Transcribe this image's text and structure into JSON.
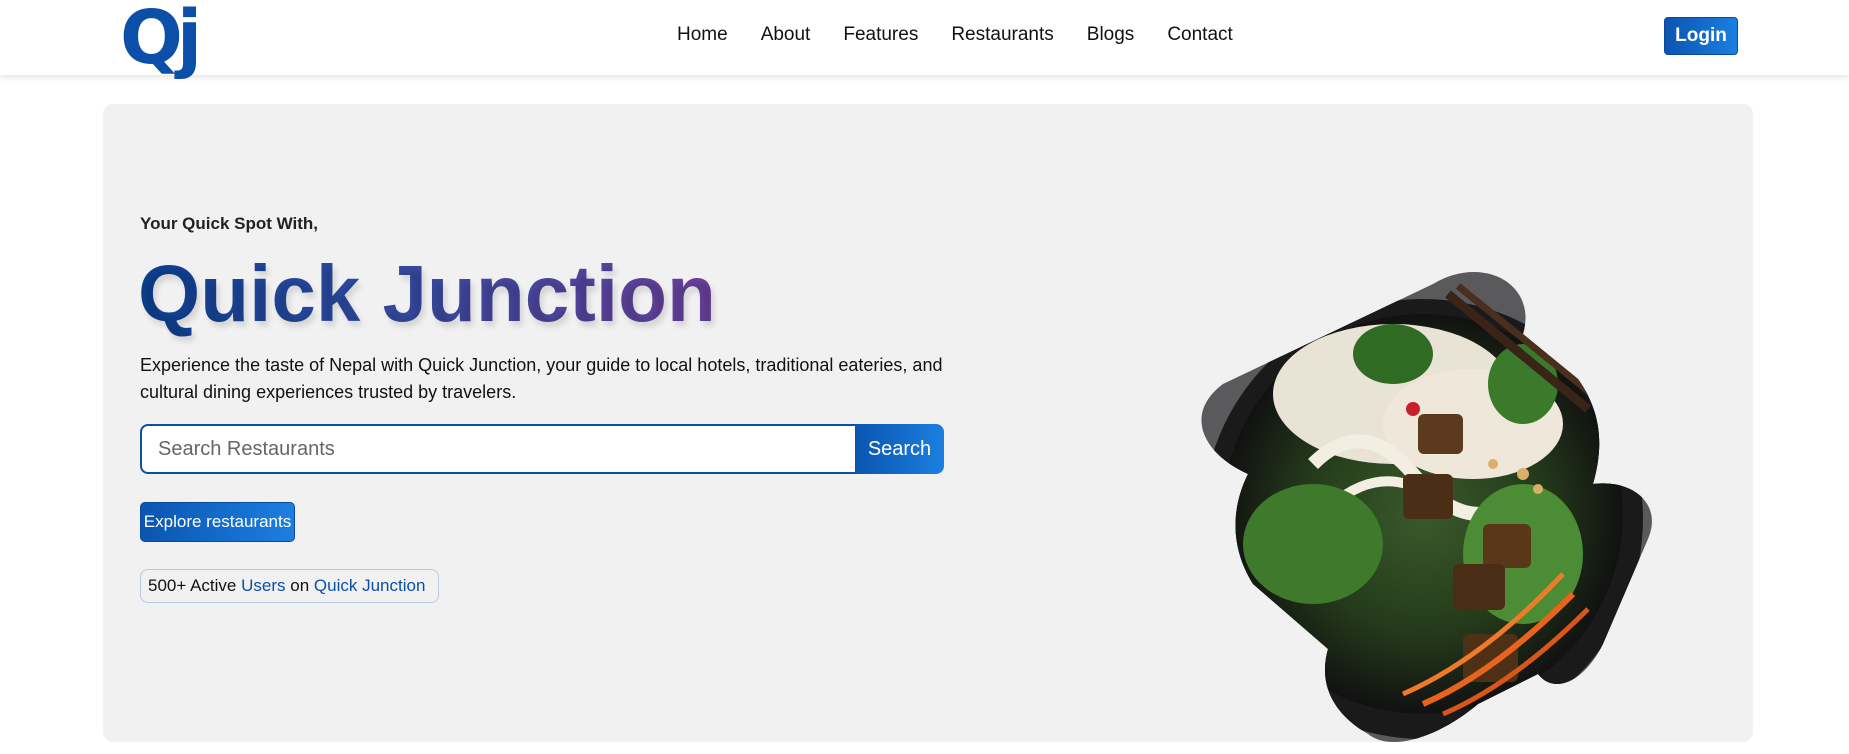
{
  "nav": {
    "logo": "Qj",
    "links": [
      "Home",
      "About",
      "Features",
      "Restaurants",
      "Blogs",
      "Contact"
    ],
    "login_label": "Login"
  },
  "hero": {
    "eyebrow": "Your Quick Spot With,",
    "title": "Quick Junction",
    "description": "Experience the taste of Nepal with Quick Junction, your guide to local hotels, traditional eateries, and cultural dining experiences trusted by travelers.",
    "search": {
      "placeholder": "Search Restaurants",
      "button_label": "Search"
    },
    "explore_label": "Explore restaurants",
    "badge": {
      "count": "500+ Active",
      "users": "Users",
      "on": "on",
      "brand": "Quick Junction"
    }
  },
  "colors": {
    "brand": "#0b4fa8",
    "hero_bg": "#f1f1f1"
  }
}
